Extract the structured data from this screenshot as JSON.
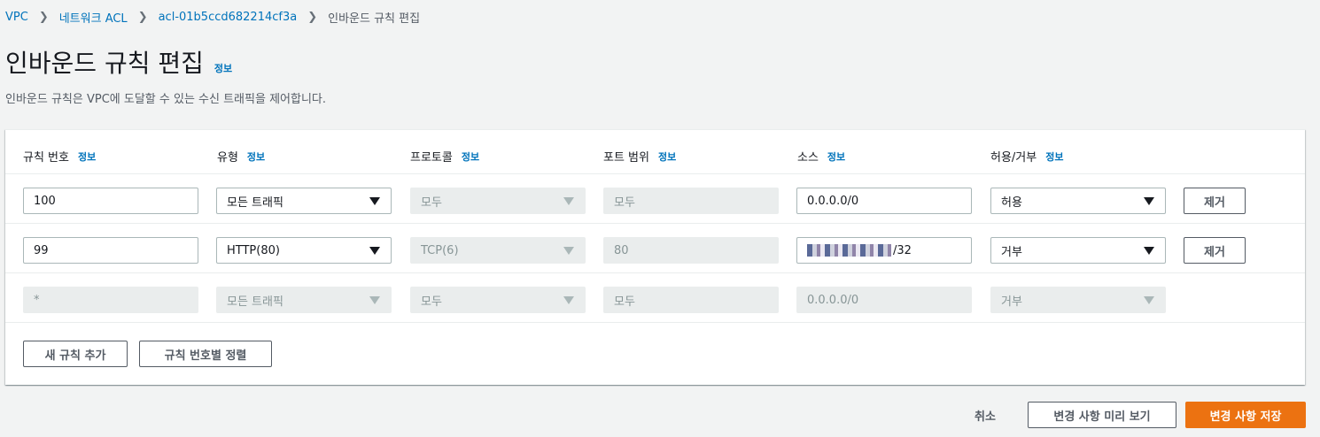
{
  "breadcrumb": {
    "items": [
      "VPC",
      "네트워크 ACL",
      "acl-01b5ccd682214cf3a"
    ],
    "current": "인바운드 규칙 편집"
  },
  "page": {
    "title": "인바운드 규칙 편집",
    "info": "정보",
    "description": "인바운드 규칙은 VPC에 도달할 수 있는 수신 트래픽을 제어합니다."
  },
  "table": {
    "columns": [
      {
        "label": "규칙 번호",
        "info": "정보"
      },
      {
        "label": "유형",
        "info": "정보"
      },
      {
        "label": "프로토콜",
        "info": "정보"
      },
      {
        "label": "포트 범위",
        "info": "정보"
      },
      {
        "label": "소스",
        "info": "정보"
      },
      {
        "label": "허용/거부",
        "info": "정보"
      }
    ],
    "rows": [
      {
        "rule_number": "100",
        "type": "모든 트래픽",
        "protocol": "모두",
        "port_range": "모두",
        "source": "0.0.0.0/0",
        "action": "허용",
        "remove": "제거"
      },
      {
        "rule_number": "99",
        "type": "HTTP(80)",
        "protocol": "TCP(6)",
        "port_range": "80",
        "source_suffix": "/32",
        "action": "거부",
        "remove": "제거"
      },
      {
        "rule_number": "*",
        "type": "모든 트래픽",
        "protocol": "모두",
        "port_range": "모두",
        "source": "0.0.0.0/0",
        "action": "거부"
      }
    ],
    "add_rule": "새 규칙 추가",
    "sort_rules": "규칙 번호별 정렬"
  },
  "footer": {
    "cancel": "취소",
    "preview": "변경 사항 미리 보기",
    "save": "변경 사항 저장"
  },
  "colors": {
    "link": "#0073bb",
    "primary": "#ec7211",
    "background": "#f2f3f3"
  }
}
